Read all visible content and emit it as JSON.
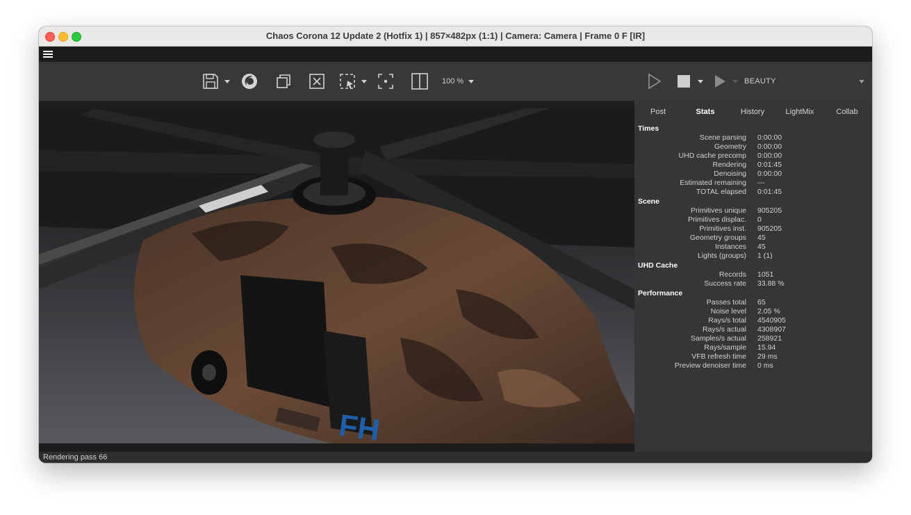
{
  "window": {
    "title": "Chaos Corona 12 Update 2 (Hotfix 1) | 857×482px (1:1) | Camera: Camera | Frame 0 F [IR]"
  },
  "toolbar": {
    "icons": [
      "save-icon",
      "corona-logo-icon",
      "copy-icon",
      "clear-icon",
      "region-select-icon",
      "focus-icon",
      "split-view-icon",
      "render-icon",
      "stop-icon",
      "interactive-render-icon"
    ],
    "zoom": "100 %",
    "render_element": "BEAUTY"
  },
  "panel": {
    "tabs": [
      {
        "label": "Post"
      },
      {
        "label": "Stats"
      },
      {
        "label": "History"
      },
      {
        "label": "LightMix"
      },
      {
        "label": "Collab"
      }
    ],
    "active_tab": "Stats"
  },
  "stats": {
    "times": {
      "title": "Times",
      "rows": [
        {
          "label": "Scene parsing",
          "value": "0:00:00"
        },
        {
          "label": "Geometry",
          "value": "0:00:00"
        },
        {
          "label": "UHD cache precomp",
          "value": "0:00:00"
        },
        {
          "label": "Rendering",
          "value": "0:01:45"
        },
        {
          "label": "Denoising",
          "value": "0:00:00"
        },
        {
          "label": "Estimated remaining",
          "value": "---"
        },
        {
          "label": "TOTAL elapsed",
          "value": "0:01:45"
        }
      ]
    },
    "scene": {
      "title": "Scene",
      "rows": [
        {
          "label": "Primitives unique",
          "value": "905205"
        },
        {
          "label": "Primitives displac.",
          "value": "0"
        },
        {
          "label": "Primitives inst.",
          "value": "905205"
        },
        {
          "label": "Geometry groups",
          "value": "45"
        },
        {
          "label": "Instances",
          "value": "45"
        },
        {
          "label": "Lights (groups)",
          "value": "1 (1)"
        }
      ]
    },
    "uhd_cache": {
      "title": "UHD Cache",
      "rows": [
        {
          "label": "Records",
          "value": "1051"
        },
        {
          "label": "Success rate",
          "value": "33.88 %"
        }
      ]
    },
    "performance": {
      "title": "Performance",
      "rows": [
        {
          "label": "Passes total",
          "value": "65"
        },
        {
          "label": "Noise level",
          "value": "2.05 %"
        },
        {
          "label": "Rays/s total",
          "value": "4540905"
        },
        {
          "label": "Rays/s actual",
          "value": "4308907"
        },
        {
          "label": "Samples/s actual",
          "value": "258921"
        },
        {
          "label": "Rays/sample",
          "value": "15.94"
        },
        {
          "label": "VFB refresh time",
          "value": "29 ms"
        },
        {
          "label": "Preview denoiser time",
          "value": "0 ms"
        }
      ]
    }
  },
  "render": {
    "fuselage_text": "FH"
  },
  "status": {
    "text": "Rendering pass 66"
  }
}
